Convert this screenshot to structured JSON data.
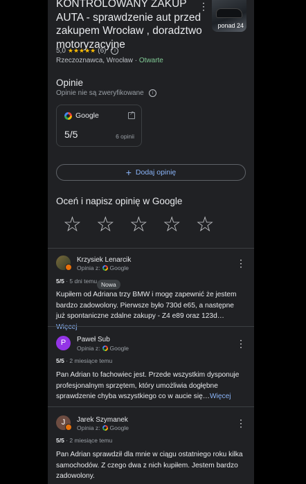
{
  "place": {
    "title": "KONTROLOWANY ZAKUP AUTA - sprawdzenie aut przed zakupem Wrocław , doradztwo motoryzacyjne",
    "photo_label": "ponad 24",
    "rating": "5,0",
    "stars": "★★★★★",
    "review_count": "(6)",
    "category": "Rzeczoznawca, Wrocław",
    "separator": " · ",
    "open_status": "Otwarte"
  },
  "reviews_section": {
    "title": "Opinie",
    "subtitle": "Opinie nie są zweryfikowane",
    "source_card": {
      "source": "Google",
      "score": "5/5",
      "count": "6 opinii"
    },
    "add_review_label": "Dodaj opinię",
    "rate_title": "Oceń i napisz opinię w Google"
  },
  "reviews": [
    {
      "author": "Krzysiek Lenarcik",
      "via_prefix": "Opinia z:",
      "via_source": "Google",
      "score": "5/5",
      "time": " · 5 dni temu",
      "badge": "Nowa",
      "text": "Kupiłem od Adriana trzy BMW i mogę zapewnić że jestem bardzo zadowolony. Pierwsze było 730d e65, a następne już spontaniczne zdalne zakupy - Z4 e89 oraz 123d…",
      "more": "Więcej",
      "avatar_color": "#5b4a2e"
    },
    {
      "author": "Paweł Sub",
      "via_prefix": "Opinia z:",
      "via_source": "Google",
      "score": "5/5",
      "time": " · 2 miesiące temu",
      "text": "Pan Adrian to fachowiec jest. Przede wszystkim dysponuje profesjonalnym sprzętem, który umożliwia dogłębne sprawdzenie chyba wszystkiego co w aucie się…",
      "more": "Więcej",
      "avatar_letter": "P",
      "avatar_color": "#9334e6"
    },
    {
      "author": "Jarek Szymanek",
      "via_prefix": "Opinia z:",
      "via_source": "Google",
      "score": "5/5",
      "time": " · 2 miesiące temu",
      "text": "Pan Adrian sprawdził dla mnie w ciągu ostatniego roku kilka samochodów. Z czego dwa z nich kupiłem. Jestem bardzo zadowolony.",
      "avatar_letter": "J",
      "avatar_color": "#6d4c41"
    }
  ],
  "colors": {
    "accent": "#8ab4f8",
    "open": "#81c995",
    "star": "#fbbc04"
  }
}
